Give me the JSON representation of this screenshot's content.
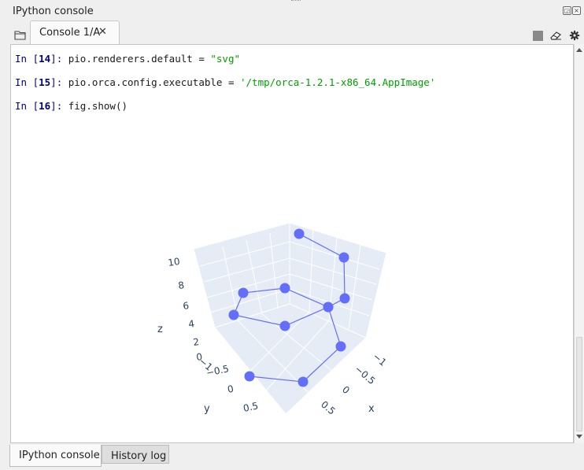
{
  "pane": {
    "title": "IPython console"
  },
  "tab": {
    "label": "Console 1/A",
    "close": "✕"
  },
  "console": {
    "lines": [
      {
        "num": "14",
        "code_pre": "pio.renderers.default = ",
        "code_str": "\"svg\""
      },
      {
        "num": "15",
        "code_pre": "pio.orca.config.executable = ",
        "code_str": "'/tmp/orca-1.2.1-x86_64.AppImage'"
      },
      {
        "num": "16",
        "code_pre": "fig.show()",
        "code_str": ""
      }
    ],
    "prompt_prefix": "In [",
    "prompt_suffix": "]: "
  },
  "plot": {
    "z_ticks": [
      "10",
      "8",
      "6",
      "4",
      "2",
      "0"
    ],
    "y_ticks": [
      "−1",
      "−0.5",
      "0",
      "0.5"
    ],
    "x_ticks": [
      "−1",
      "−0.5",
      "0",
      "0.5"
    ],
    "z_label": "z",
    "y_label": "y",
    "x_label": "x",
    "marker_color": "#636efa"
  },
  "bottom_tabs": {
    "active": "IPython console",
    "inactive": "History log"
  }
}
